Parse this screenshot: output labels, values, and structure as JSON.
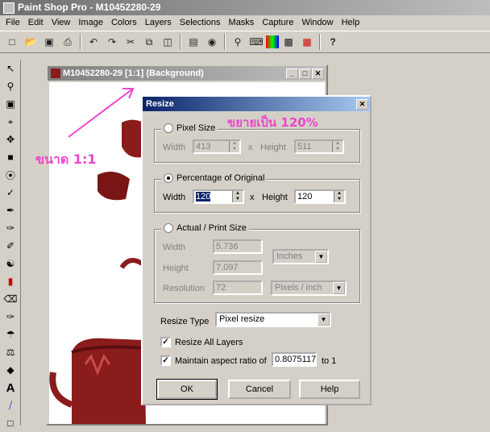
{
  "app": {
    "title": "Paint Shop Pro - M10452280-29"
  },
  "menu": [
    "File",
    "Edit",
    "View",
    "Image",
    "Colors",
    "Layers",
    "Selections",
    "Masks",
    "Capture",
    "Window",
    "Help"
  ],
  "image_window": {
    "title": "M10452280-29 [1:1] (Background)"
  },
  "annotations": {
    "left": "ขนาด 1:1",
    "top": "ขยายเป็น 120%"
  },
  "dialog": {
    "title": "Resize",
    "pixel_size": {
      "label": "Pixel Size",
      "width_label": "Width",
      "height_label": "Height",
      "width": "413",
      "height": "511",
      "x": "x"
    },
    "percentage": {
      "label": "Percentage of Original",
      "width_label": "Width",
      "height_label": "Height",
      "width": "120",
      "height": "120",
      "x": "x"
    },
    "actual": {
      "label": "Actual / Print Size",
      "width_label": "Width",
      "height_label": "Height",
      "resolution_label": "Resolution",
      "width": "5.736",
      "height": "7.097",
      "resolution": "72",
      "units": "Inches",
      "res_units": "Pixels / inch"
    },
    "resize_type_label": "Resize Type",
    "resize_type": "Pixel resize",
    "resize_all_layers": "Resize All Layers",
    "maintain_aspect": "Maintain aspect ratio of",
    "aspect_value": "0.8075117",
    "aspect_to": "to 1",
    "ok": "OK",
    "cancel": "Cancel",
    "help": "Help"
  },
  "colors": {
    "annotation": "#ee44cc",
    "cup_red": "#8b1c1c"
  }
}
